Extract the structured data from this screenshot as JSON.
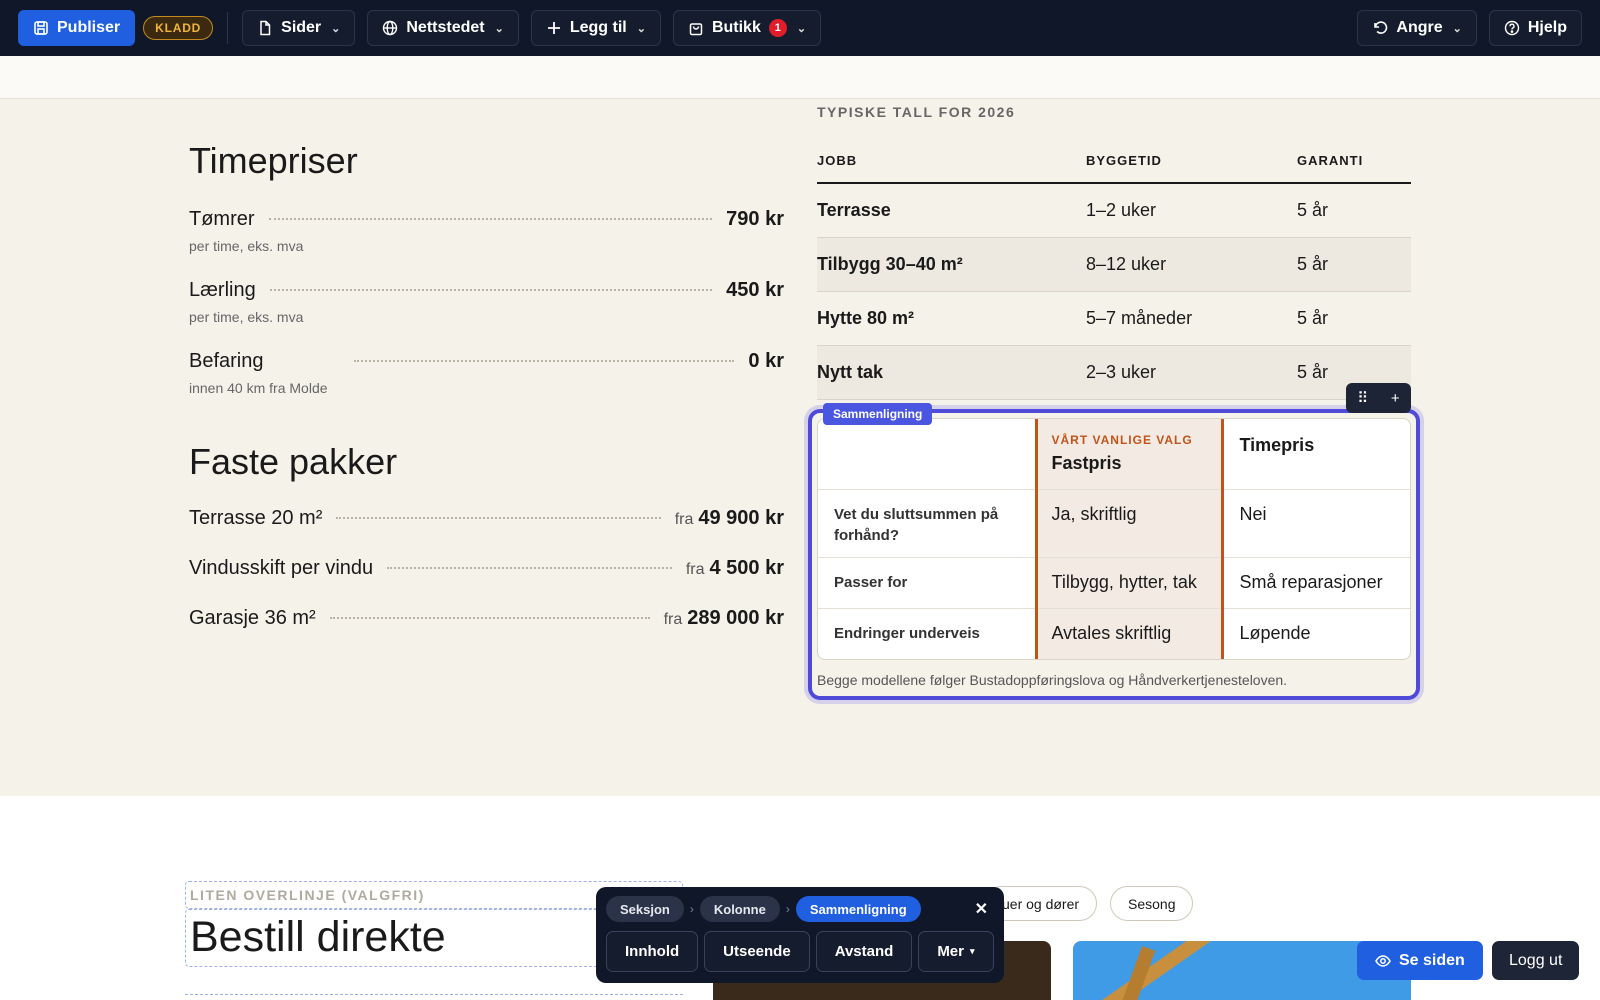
{
  "toolbar": {
    "publish_label": "Publiser",
    "draft_badge": "KLADD",
    "pages_label": "Sider",
    "site_label": "Nettstedet",
    "add_label": "Legg til",
    "shop_label": "Butikk",
    "shop_count": "1",
    "undo_label": "Angre",
    "help_label": "Hjelp"
  },
  "pricing": {
    "hourly_title": "Timepriser",
    "hourly": [
      {
        "name": "Tømrer",
        "value": "790 kr",
        "note": "per time, eks. mva"
      },
      {
        "name": "Lærling",
        "value": "450 kr",
        "note": "per time, eks. mva"
      },
      {
        "name": "Befaring",
        "value": "0 kr",
        "note": "innen 40 km fra Molde"
      }
    ],
    "packages_title": "Faste pakker",
    "packages": [
      {
        "name": "Terrasse 20 m²",
        "prefix": "fra",
        "value": "49 900 kr"
      },
      {
        "name": "Vindusskift per vindu",
        "prefix": "fra",
        "value": "4 500 kr"
      },
      {
        "name": "Garasje 36 m²",
        "prefix": "fra",
        "value": "289 000 kr"
      }
    ]
  },
  "job_table": {
    "overline": "TYPISKE TALL FOR 2026",
    "headers": [
      "JOBB",
      "BYGGETID",
      "GARANTI"
    ],
    "rows": [
      [
        "Terrasse",
        "1–2 uker",
        "5 år"
      ],
      [
        "Tilbygg 30–40 m²",
        "8–12 uker",
        "5 år"
      ],
      [
        "Hytte 80 m²",
        "5–7 måneder",
        "5 år"
      ],
      [
        "Nytt tak",
        "2–3 uker",
        "5 år"
      ]
    ]
  },
  "comparison": {
    "tag": "Sammenligning",
    "col_fast_sub": "VÅRT VANLIGE VALG",
    "col_fast": "Fastpris",
    "col_hour": "Timepris",
    "rows": [
      {
        "label": "Vet du sluttsummen på forhånd?",
        "fast": "Ja, skriftlig",
        "hour": "Nei"
      },
      {
        "label": "Passer for",
        "fast": "Tilbygg, hytter, tak",
        "hour": "Små reparasjoner"
      },
      {
        "label": "Endringer underveis",
        "fast": "Avtales skriftlig",
        "hour": "Løpende"
      }
    ],
    "note": "Begge modellene følger Bustadoppføringslova og Håndverkertjenesteloven."
  },
  "bottom": {
    "overline": "LITEN OVERLINJE (VALGFRI)",
    "heading": "Bestill direkte",
    "chips": [
      "uer og dører",
      "Sesong"
    ]
  },
  "editor_panel": {
    "crumbs": [
      "Seksjon",
      "Kolonne",
      "Sammenligning"
    ],
    "tabs": [
      "Innhold",
      "Utseende",
      "Avstand",
      "Mer"
    ]
  },
  "floating": {
    "see_page": "Se siden",
    "logout": "Logg ut"
  }
}
